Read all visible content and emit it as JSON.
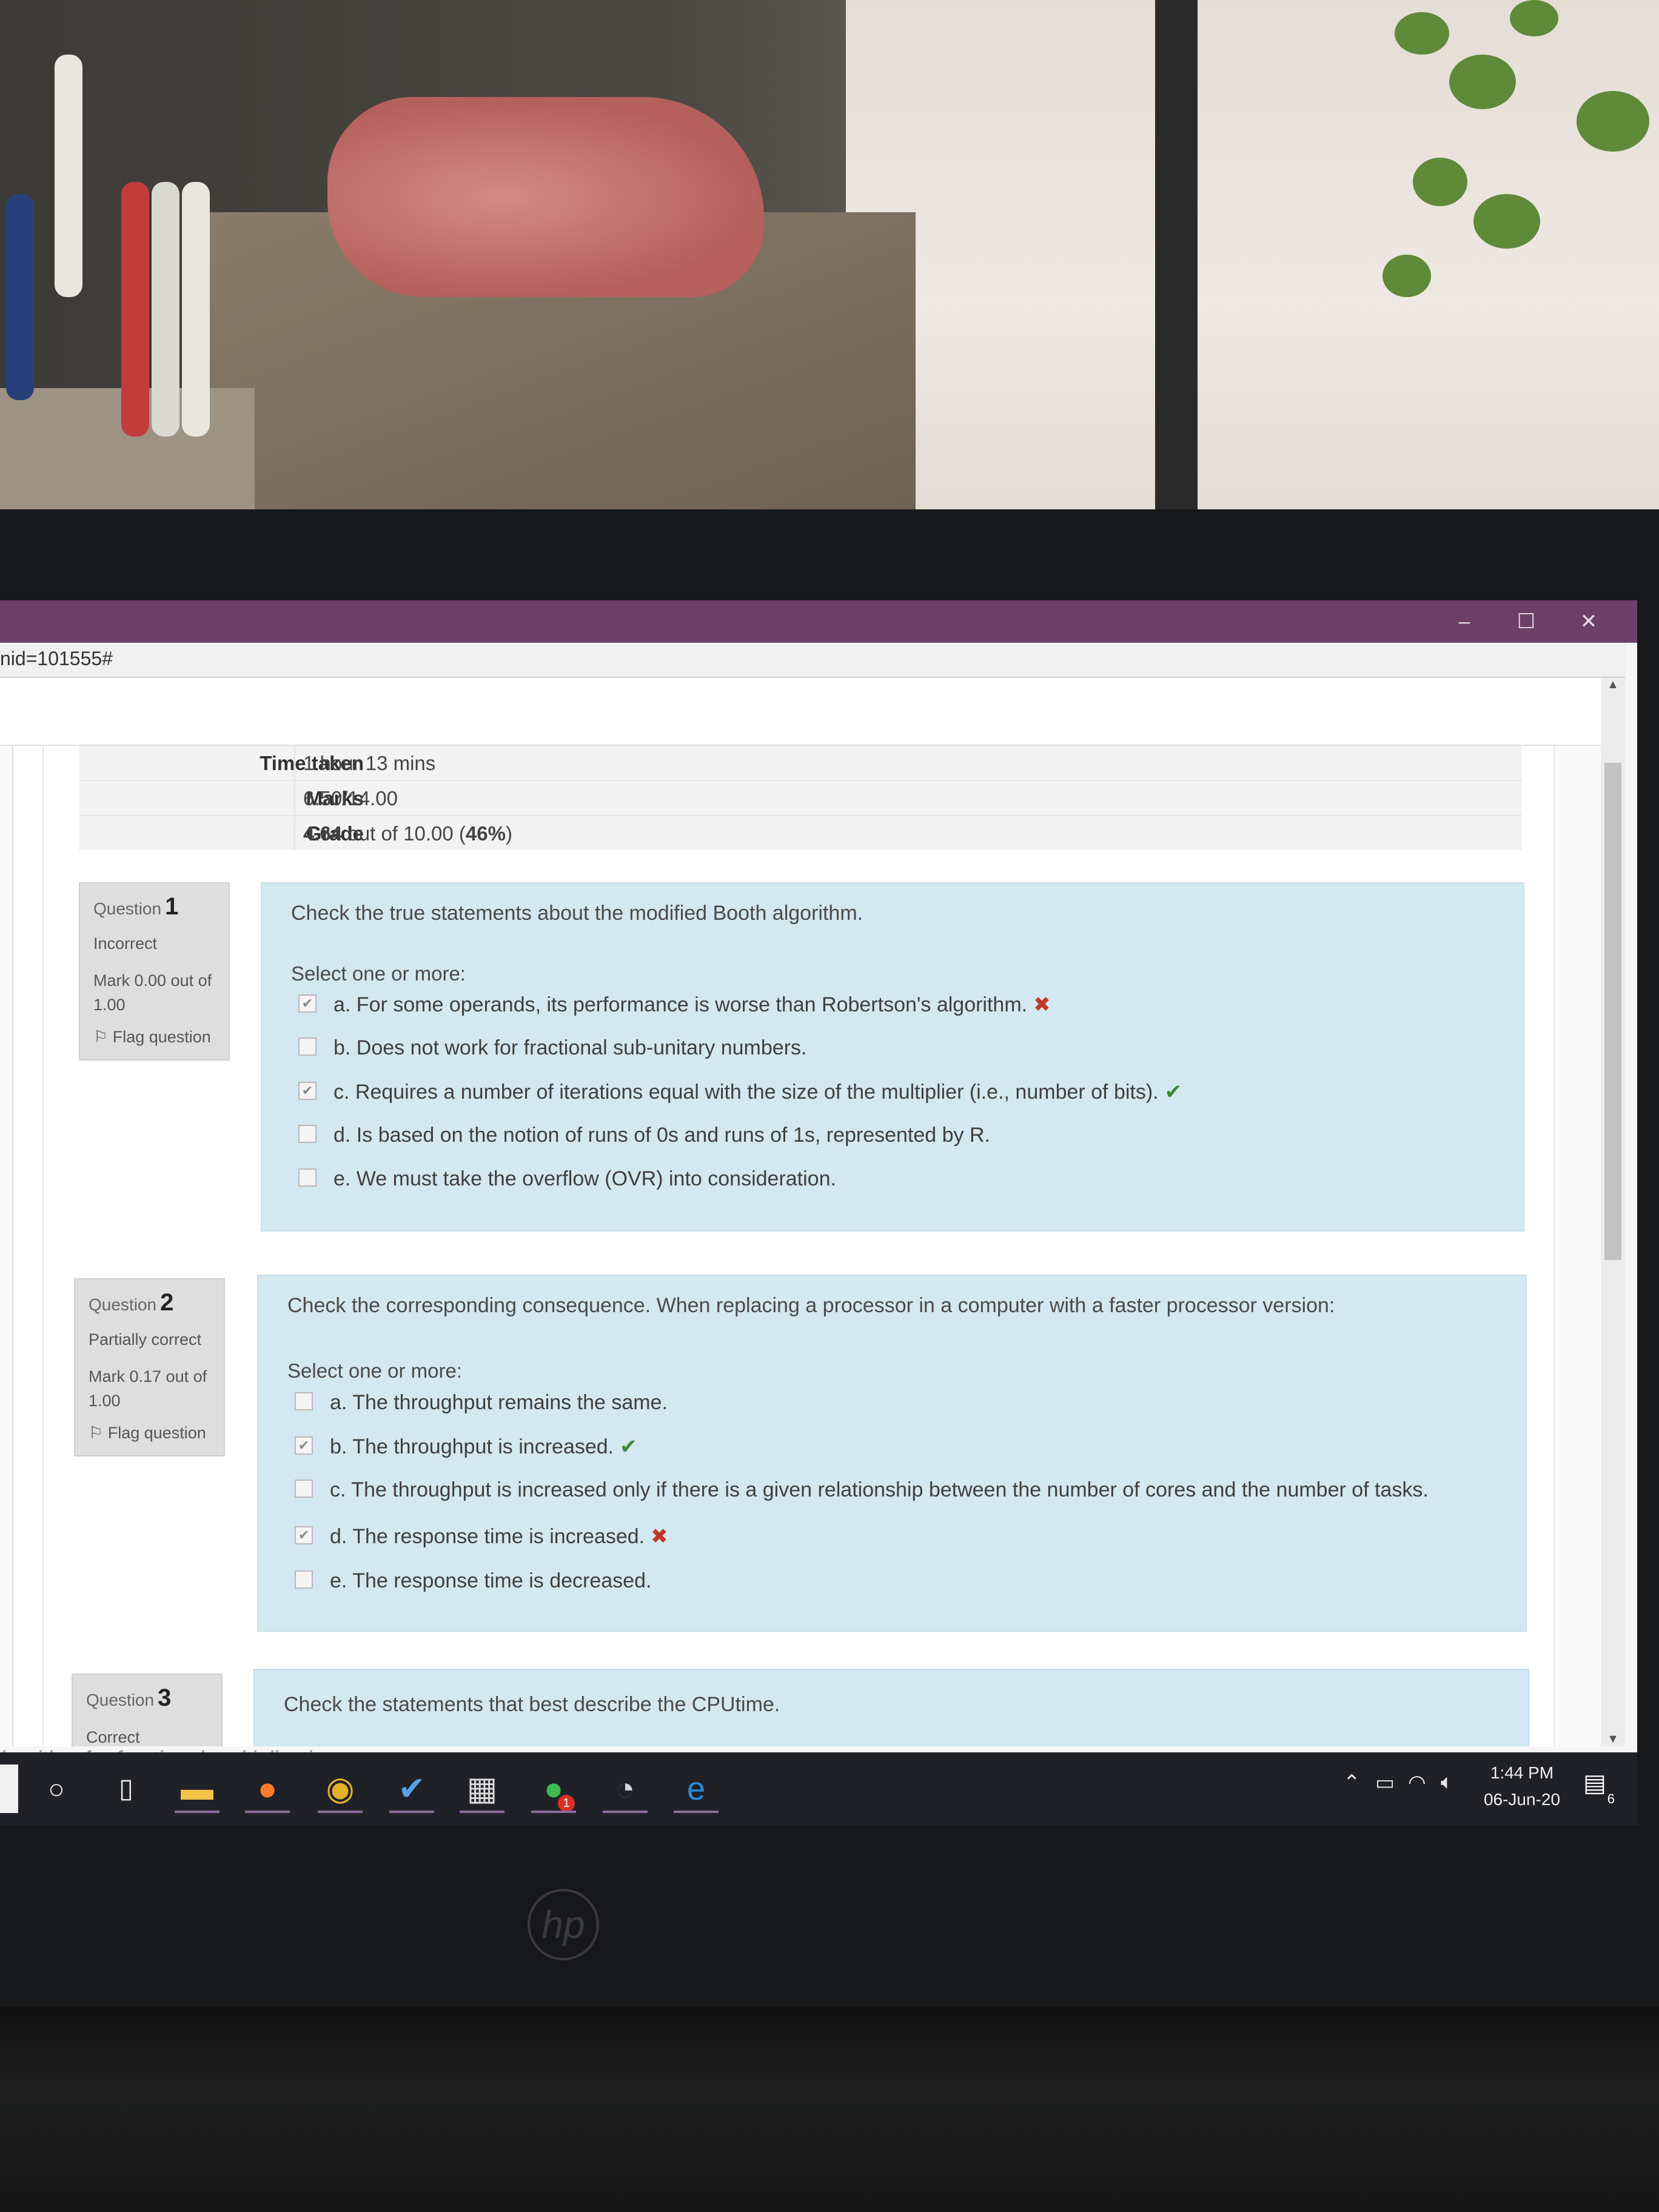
{
  "browser": {
    "url_fragment": "nid=101555#"
  },
  "window_controls": {
    "minimize": "–",
    "maximize": "☐",
    "close": "✕"
  },
  "summary": {
    "time_taken_label": "Time taken",
    "time_taken_value": "1 hour 13 mins",
    "marks_label": "Marks",
    "marks_value": "6.50/14.00",
    "grade_label": "Grade",
    "grade_value": "4.64",
    "grade_out_of": "out of 10.00",
    "grade_percent": "46%"
  },
  "questions": [
    {
      "label": "Question",
      "number": "1",
      "state": "Incorrect",
      "mark": "Mark 0.00 out of 1.00",
      "flag": "Flag question",
      "text": "Check the true statements about the modified Booth algorithm.",
      "select_hint": "Select one or more:",
      "options": [
        {
          "text": "a. For some operands, its performance is worse than Robertson's algorithm.",
          "checked": true,
          "feedback": "incorrect"
        },
        {
          "text": "b. Does not work for fractional sub-unitary numbers.",
          "checked": false,
          "feedback": ""
        },
        {
          "text": "c. Requires a number of iterations equal with the size of the multiplier (i.e., number of bits).",
          "checked": true,
          "feedback": "correct"
        },
        {
          "text": "d. Is based on the notion of runs of 0s and runs of 1s, represented by R.",
          "checked": false,
          "feedback": ""
        },
        {
          "text": "e. We must take the overflow (OVR) into consideration.",
          "checked": false,
          "feedback": ""
        }
      ]
    },
    {
      "label": "Question",
      "number": "2",
      "state": "Partially correct",
      "mark": "Mark 0.17 out of 1.00",
      "flag": "Flag question",
      "text": "Check the corresponding consequence. When replacing a processor in a computer with a faster processor version:",
      "select_hint": "Select one or more:",
      "options": [
        {
          "text": "a. The throughput remains the same.",
          "checked": false,
          "feedback": ""
        },
        {
          "text": "b. The throughput is increased.",
          "checked": true,
          "feedback": "correct"
        },
        {
          "text": "c. The throughput is increased only if there is a given relationship between the number of cores and the number of tasks.",
          "checked": false,
          "feedback": ""
        },
        {
          "text": "d. The response time is increased.",
          "checked": true,
          "feedback": "incorrect"
        },
        {
          "text": "e. The response time is decreased.",
          "checked": false,
          "feedback": ""
        }
      ]
    },
    {
      "label": "Question",
      "number": "3",
      "state": "Correct",
      "text": "Check the statements that best describe the CPUtime."
    }
  ],
  "under_text": "lgorithm for fractional multiplication",
  "taskbar": {
    "time": "1:44 PM",
    "date": "06-Jun-20",
    "notification_count": "6",
    "chat_badge": "1",
    "icons": [
      "cortana-icon",
      "task-view-icon",
      "file-explorer-icon",
      "firefox-icon",
      "chrome-icon",
      "steam-icon",
      "calculator-icon",
      "whatsapp-icon",
      "cd-player-icon",
      "edge-icon"
    ]
  },
  "colors": {
    "titlebar": "#6d3f66",
    "question_bg": "#d3e8f0",
    "info_bg": "#dedede",
    "correct": "#3a8a2f",
    "incorrect": "#c0392b"
  }
}
